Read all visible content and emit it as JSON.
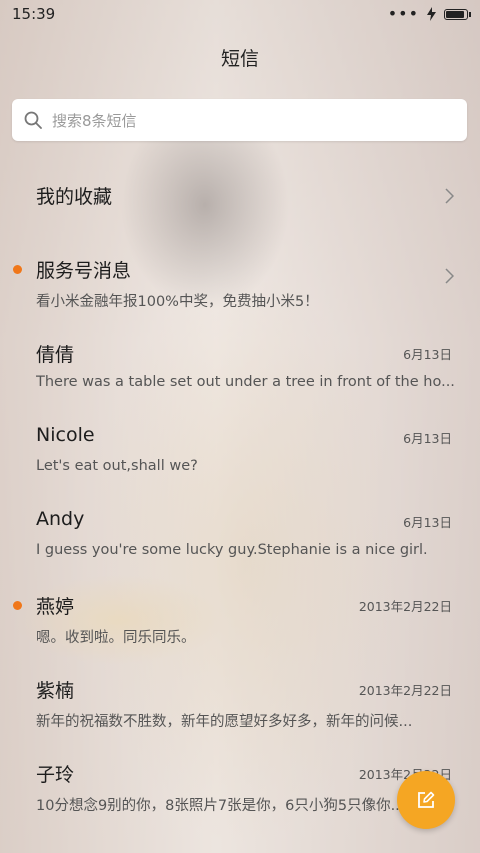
{
  "status_bar": {
    "time": "15:39"
  },
  "header": {
    "title": "短信"
  },
  "search": {
    "placeholder": "搜索8条短信"
  },
  "items": [
    {
      "name": "我的收藏",
      "preview": "",
      "date": "",
      "unread": false,
      "chevron": true
    },
    {
      "name": "服务号消息",
      "preview": "看小米金融年报100%中奖，免费抽小米5！",
      "date": "",
      "unread": true,
      "chevron": true
    },
    {
      "name": "倩倩",
      "preview": "There was a table set out under a tree in front of the ho...",
      "date": "6月13日",
      "unread": false,
      "chevron": false
    },
    {
      "name": "Nicole",
      "preview": "Let's eat out,shall we?",
      "date": "6月13日",
      "unread": false,
      "chevron": false
    },
    {
      "name": "Andy",
      "preview": "I guess you're some lucky guy.Stephanie is a nice girl.",
      "date": "6月13日",
      "unread": false,
      "chevron": false
    },
    {
      "name": "燕婷",
      "preview": "嗯。收到啦。同乐同乐。",
      "date": "2013年2月22日",
      "unread": true,
      "chevron": false
    },
    {
      "name": "紫楠",
      "preview": "新年的祝福数不胜数，新年的愿望好多好多，新年的问候...",
      "date": "2013年2月22日",
      "unread": false,
      "chevron": false
    },
    {
      "name": "子玲",
      "preview": "10分想念9别的你，8张照片7张是你，6只小狗5只像你...",
      "date": "2013年2月22日",
      "unread": false,
      "chevron": false
    }
  ],
  "colors": {
    "accent": "#f5a623",
    "unread_dot": "#f0771a"
  },
  "icons": {
    "search": "search-icon",
    "chevron": "chevron-right-icon",
    "compose": "compose-icon"
  }
}
